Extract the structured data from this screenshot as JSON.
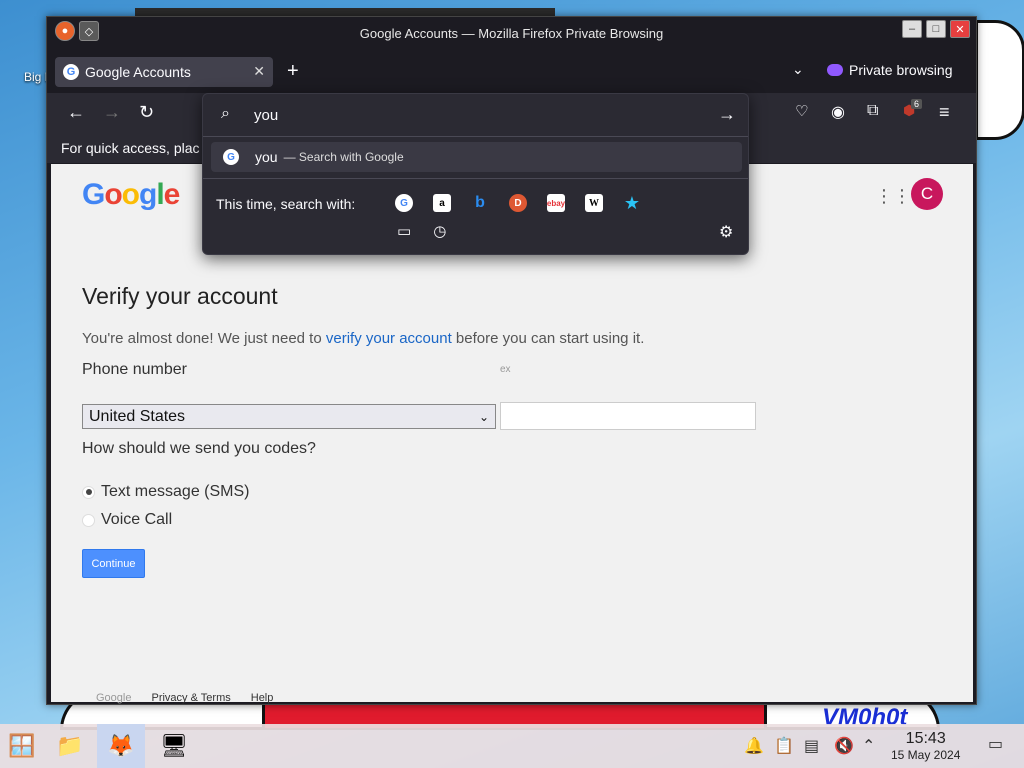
{
  "desktop": {
    "icon_label": "Big De",
    "vm_label": "VM0h0t"
  },
  "window": {
    "title": "Google Accounts — Mozilla Firefox Private Browsing"
  },
  "tabs": [
    {
      "label": "Google Accounts",
      "favicon": "google-icon",
      "active": true
    }
  ],
  "private_label": "Private browsing",
  "bookmarks_text": "For quick access, plac",
  "extension_badge": "6",
  "url_dropdown": {
    "input_value": "you",
    "suggestion_term": "you",
    "suggestion_sub": "Search with Google",
    "this_time_label": "This time, search with:",
    "engines": [
      "google",
      "amazon",
      "bing",
      "duckduckgo",
      "ebay",
      "wikipedia",
      "bookmarks-star"
    ]
  },
  "page": {
    "logo": "Google",
    "avatar_initial": "C",
    "heading": "Verify your account",
    "intro_before": "You're almost done! We just need to",
    "intro_link": "verify your account",
    "intro_after": "before you can start using it.",
    "phone_label": "Phone number",
    "phone_example": "ex",
    "country_selected": "United States",
    "phone_value": "",
    "question": "How should we send you codes?",
    "options": [
      {
        "label": "Text message (SMS)",
        "selected": true
      },
      {
        "label": "Voice Call",
        "selected": false
      }
    ],
    "continue_label": "Continue",
    "footer": {
      "google": "Google",
      "privacy": "Privacy & Terms",
      "help": "Help"
    }
  },
  "taskbar": {
    "time": "15:43",
    "date": "15 May 2024"
  },
  "colors": {
    "accent_blue": "#4d90fe",
    "avatar": "#c8175d",
    "private_purple": "#9059ff",
    "firefox_dark": "#2b2a33"
  }
}
